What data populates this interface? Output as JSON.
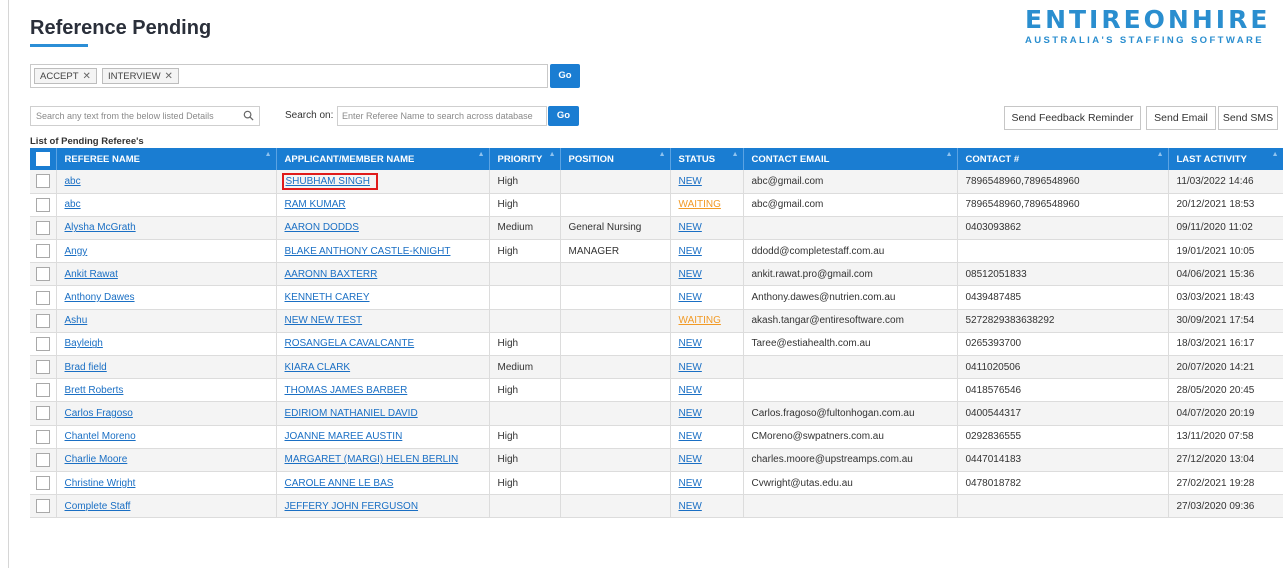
{
  "page": {
    "title": "Reference Pending"
  },
  "logo": {
    "main": "ENTIREONHIRE",
    "tagline": "AUSTRALIA'S STAFFING SOFTWARE"
  },
  "filter": {
    "tags": [
      "ACCEPT",
      "INTERVIEW"
    ],
    "go_label": "Go"
  },
  "search": {
    "local_placeholder": "Search any text from the below listed Details",
    "search_on_label": "Search on:",
    "database_placeholder": "Enter Referee Name to search across database",
    "go_label": "Go"
  },
  "actions": {
    "feedback_reminder": "Send Feedback Reminder",
    "send_email": "Send Email",
    "send_sms": "Send SMS"
  },
  "list_title": "List of Pending Referee's",
  "table": {
    "columns": [
      "REFEREE NAME",
      "APPLICANT/MEMBER NAME",
      "PRIORITY",
      "POSITION",
      "STATUS",
      "CONTACT EMAIL",
      "CONTACT #",
      "LAST ACTIVITY"
    ],
    "rows": [
      {
        "referee": "abc",
        "applicant": "SHUBHAM SINGH",
        "priority": "High",
        "position": "",
        "status": "NEW",
        "email": "abc@gmail.com",
        "contact": "7896548960,7896548960",
        "last_activity": "11/03/2022 14:46",
        "highlighted": true
      },
      {
        "referee": "abc",
        "applicant": "RAM KUMAR",
        "priority": "High",
        "position": "",
        "status": "WAITING",
        "email": "abc@gmail.com",
        "contact": "7896548960,7896548960",
        "last_activity": "20/12/2021 18:53"
      },
      {
        "referee": "Alysha McGrath",
        "applicant": "AARON DODDS",
        "priority": "Medium",
        "position": "General Nursing",
        "status": "NEW",
        "email": "",
        "contact": "0403093862",
        "last_activity": "09/11/2020 11:02"
      },
      {
        "referee": "Angy",
        "applicant": "BLAKE ANTHONY CASTLE-KNIGHT",
        "priority": "High",
        "position": "MANAGER",
        "status": "NEW",
        "email": "ddodd@completestaff.com.au",
        "contact": "",
        "last_activity": "19/01/2021 10:05"
      },
      {
        "referee": "Ankit Rawat",
        "applicant": "AARONN BAXTERR",
        "priority": "",
        "position": "",
        "status": "NEW",
        "email": "ankit.rawat.pro@gmail.com",
        "contact": "08512051833",
        "last_activity": "04/06/2021 15:36"
      },
      {
        "referee": "Anthony Dawes",
        "applicant": "KENNETH CAREY",
        "priority": "",
        "position": "",
        "status": "NEW",
        "email": "Anthony.dawes@nutrien.com.au",
        "contact": "0439487485",
        "last_activity": "03/03/2021 18:43"
      },
      {
        "referee": "Ashu",
        "applicant": "NEW NEW TEST",
        "priority": "",
        "position": "",
        "status": "WAITING",
        "email": "akash.tangar@entiresoftware.com",
        "contact": "5272829383638292",
        "last_activity": "30/09/2021 17:54"
      },
      {
        "referee": "Bayleigh",
        "applicant": "ROSANGELA CAVALCANTE",
        "priority": "High",
        "position": "",
        "status": "NEW",
        "email": "Taree@estiahealth.com.au",
        "contact": "0265393700",
        "last_activity": "18/03/2021 16:17"
      },
      {
        "referee": "Brad field",
        "applicant": "KIARA CLARK",
        "priority": "Medium",
        "position": "",
        "status": "NEW",
        "email": "",
        "contact": "0411020506",
        "last_activity": "20/07/2020 14:21"
      },
      {
        "referee": "Brett Roberts",
        "applicant": "THOMAS JAMES BARBER",
        "priority": "High",
        "position": "",
        "status": "NEW",
        "email": "",
        "contact": "0418576546",
        "last_activity": "28/05/2020 20:45"
      },
      {
        "referee": "Carlos Fragoso",
        "applicant": "EDIRIOM NATHANIEL DAVID",
        "priority": "",
        "position": "",
        "status": "NEW",
        "email": "Carlos.fragoso@fultonhogan.com.au",
        "contact": "0400544317",
        "last_activity": "04/07/2020 20:19"
      },
      {
        "referee": "Chantel Moreno",
        "applicant": "JOANNE MAREE AUSTIN",
        "priority": "High",
        "position": "",
        "status": "NEW",
        "email": "CMoreno@swpatners.com.au",
        "contact": "0292836555",
        "last_activity": "13/11/2020 07:58"
      },
      {
        "referee": "Charlie Moore",
        "applicant": "MARGARET (MARGI) HELEN BERLIN",
        "priority": "High",
        "position": "",
        "status": "NEW",
        "email": "charles.moore@upstreamps.com.au",
        "contact": "0447014183",
        "last_activity": "27/12/2020 13:04"
      },
      {
        "referee": "Christine Wright",
        "applicant": "CAROLE ANNE LE BAS",
        "priority": "High",
        "position": "",
        "status": "NEW",
        "email": "Cvwright@utas.edu.au",
        "contact": "0478018782",
        "last_activity": "27/02/2021 19:28"
      },
      {
        "referee": "Complete Staff",
        "applicant": "JEFFERY JOHN FERGUSON",
        "priority": "",
        "position": "",
        "status": "NEW",
        "email": "",
        "contact": "",
        "last_activity": "27/03/2020 09:36"
      }
    ]
  }
}
